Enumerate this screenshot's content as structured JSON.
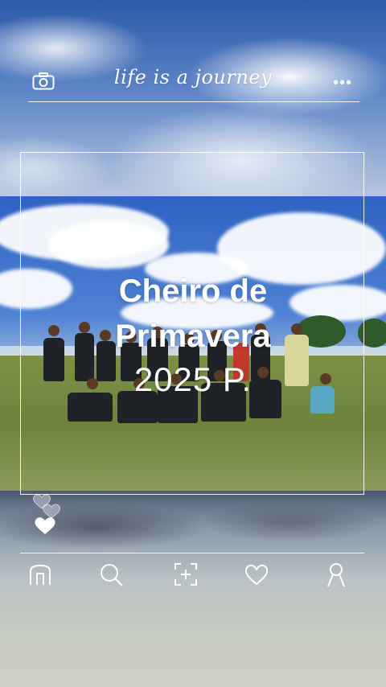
{
  "header": {
    "camera_icon": "camera-icon",
    "tagline": "life is a journey",
    "more_icon": "more-dots-icon",
    "more_label": "•••"
  },
  "post": {
    "title_line1": "Cheiro de",
    "title_line2": "Primavera",
    "title_line3": "2025 P."
  },
  "reactions": {
    "icons": [
      "heart-outline-icon",
      "heart-filled-icon"
    ]
  },
  "nav": {
    "items": [
      {
        "icon": "home-icon"
      },
      {
        "icon": "search-icon"
      },
      {
        "icon": "add-post-icon"
      },
      {
        "icon": "like-heart-icon"
      },
      {
        "icon": "profile-icon"
      }
    ]
  },
  "colors": {
    "overlay_text": "#ffffff",
    "sky": "#2f63c2",
    "grass": "#6d843d"
  }
}
